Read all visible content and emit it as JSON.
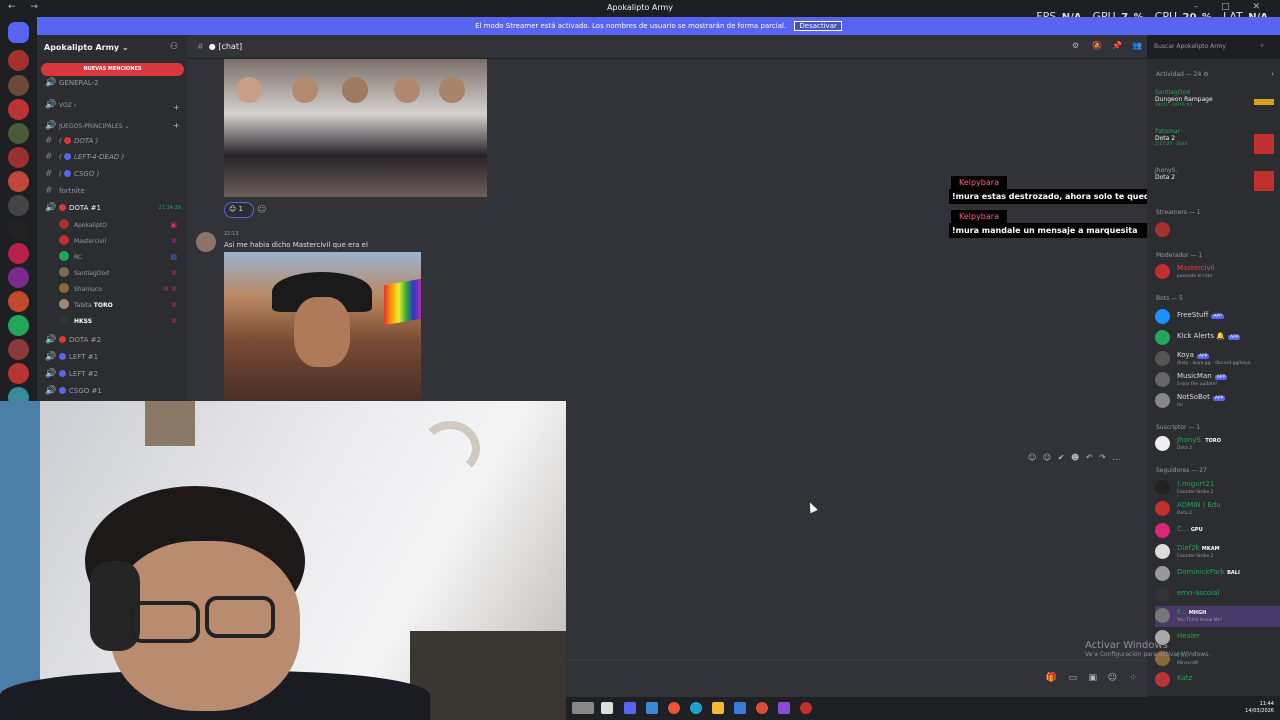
{
  "window": {
    "title": "Apokalipto Army"
  },
  "perf": {
    "fps_label": "FPS",
    "fps": "N/A",
    "gpu_label": "GPU",
    "gpu": "7 %",
    "cpu_label": "CPU",
    "cpu": "20 %",
    "lat_label": "LAT",
    "lat": "N/A"
  },
  "banner": {
    "text": "El modo Streamer está activado. Los nombres de usuario se mostrarán de forma parcial.",
    "button": "Desactivar"
  },
  "server": {
    "name": "Apokalipto Army",
    "mentions": "NUEVAS MENCIONES"
  },
  "channels": [
    {
      "name": "GENERAL-2"
    },
    {
      "name": "VOZ"
    },
    {
      "name": "JUEGOS-PRINCIPALES"
    },
    {
      "name": "DOTA"
    },
    {
      "name": "LEFT-4-DEAD"
    },
    {
      "name": "CSGO"
    },
    {
      "name": "fortnite"
    },
    {
      "name": "DOTA #1",
      "badge": "21:14:39"
    },
    {
      "name": "DOTA #2"
    },
    {
      "name": "LEFT #1"
    },
    {
      "name": "LEFT #2"
    },
    {
      "name": "CSGO #1"
    }
  ],
  "voice_users": [
    "ApokaliptO",
    "Mastercivil",
    "RC",
    "SantiagOod",
    "Shamuco",
    "Tabita",
    "HKSS"
  ],
  "voice_extra": {
    "toro": "TORO"
  },
  "topbar": {
    "channel": "[chat]",
    "search_placeholder": "Buscar Apokalipto Army"
  },
  "chat": {
    "reaction_count": "1",
    "msg2_meta": "22:13",
    "msg2_text": "Asi me habia dicho Mastercivil que era el"
  },
  "overlay": [
    {
      "name": "Kelpybara",
      "text": "!mura estas destrozado, ahora solo te queda mamita marquesita"
    },
    {
      "name": "Kelpybara",
      "text": "!mura mandale un mensaje a marquesita"
    }
  ],
  "members": {
    "activity_header": "Actividad — 24",
    "activity": [
      {
        "name": "SantiagOod",
        "game": "Dungeon Rampage",
        "time": "29:01",
        "tag": "DOTA #1"
      },
      {
        "name": "Patomar",
        "game": "Dota 2",
        "time": "2:27:20",
        "tag": "Dota"
      },
      {
        "name": "JhonyS.",
        "game": "Dota 2"
      }
    ],
    "streamers_header": "Streamers — 1",
    "moderator_header": "Moderador — 1",
    "moderator": {
      "name": "Mastercivil",
      "status": "pasando el rato"
    },
    "bots_header": "Bots — 5",
    "bots": [
      {
        "name": "FreeStuff",
        "tag": "APP",
        "status": ""
      },
      {
        "name": "Kick Alerts",
        "tag": "APP",
        "status": ""
      },
      {
        "name": "Koya",
        "tag": "APP",
        "status": "/help - koya.gg - discord.gg/koya"
      },
      {
        "name": "MusicMan",
        "tag": "APP",
        "status": "Enjoy the update!"
      },
      {
        "name": "NotSoBot",
        "tag": "APP",
        "status": "for"
      }
    ],
    "sub_header": "Suscriptor — 1",
    "sub": {
      "name": "JhonyS.",
      "tag": "TORO",
      "status": "Dota 2"
    },
    "followers_header": "Seguidores — 27",
    "followers": [
      {
        "name": "!.migurt21",
        "status": "Counter-Strike 2"
      },
      {
        "name": "ADMIN | Edu",
        "status": "Dota 2"
      },
      {
        "name": "C...",
        "tag": "GPU",
        "status": ""
      },
      {
        "name": "Dief2k",
        "tag": "MKAM",
        "status": "Counter-Strike 2"
      },
      {
        "name": "DominickPark",
        "tag": "BALI",
        "status": ""
      },
      {
        "name": "emo-ascoial",
        "status": ""
      },
      {
        "name": "F...",
        "tag": "MHGH",
        "status": "You Think Know Me!"
      },
      {
        "name": "Healer",
        "status": ""
      },
      {
        "name": "H...",
        "status": "Minecraft"
      },
      {
        "name": "Katz",
        "status": ""
      }
    ]
  },
  "watermark": {
    "line1": "Activar Windows",
    "line2": "Ve a Configuración para activar Windows."
  },
  "clock": {
    "time": "11:44",
    "date": "14/03/2026"
  },
  "colors": {
    "accent": "#5865f2",
    "danger": "#da373c",
    "online": "#23a55a",
    "overlay_name": "#ff5c8a"
  }
}
